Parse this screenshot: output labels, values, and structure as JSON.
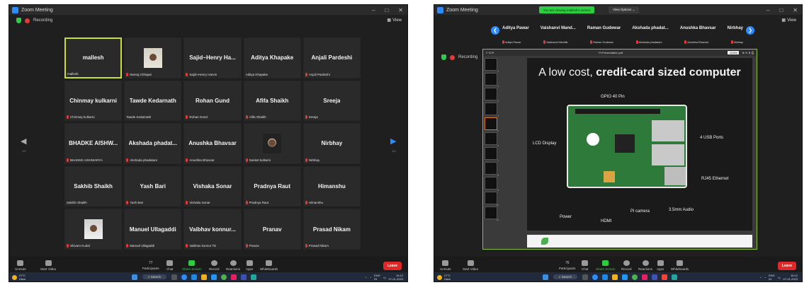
{
  "left": {
    "window_title": "Zoom Meeting",
    "recording": "Recording",
    "view": "View",
    "tiles": [
      {
        "name": "mallesh",
        "label": "mallesh",
        "active": true,
        "photo": "",
        "muted": false
      },
      {
        "name": "",
        "label": "Neeraj Chhajed",
        "active": false,
        "photo": "p1",
        "muted": true
      },
      {
        "name": "Sajid~Henry Ha...",
        "label": "Sajid~Henry Harvin",
        "active": false,
        "photo": "",
        "muted": true
      },
      {
        "name": "Aditya Khapake",
        "label": "Aditya Khapake",
        "active": false,
        "photo": "",
        "muted": false
      },
      {
        "name": "Anjali Pardeshi",
        "label": "Anjali Pardeshi",
        "active": false,
        "photo": "",
        "muted": true
      },
      {
        "name": "Chinmay kulkarni",
        "label": "Chinmay kulkarni",
        "active": false,
        "photo": "",
        "muted": true
      },
      {
        "name": "Tawde Kedarnath",
        "label": "Tawde Kedarnath",
        "active": false,
        "photo": "",
        "muted": false
      },
      {
        "name": "Rohan Gund",
        "label": "Rohan Gund",
        "active": false,
        "photo": "",
        "muted": true
      },
      {
        "name": "Afifa Shaikh",
        "label": "Afifa Shaikh",
        "active": false,
        "photo": "",
        "muted": true
      },
      {
        "name": "Sreeja",
        "label": "Sreeja",
        "active": false,
        "photo": "",
        "muted": true
      },
      {
        "name": "BHADKE AISHW...",
        "label": "BHADKE AISHWARYA",
        "active": false,
        "photo": "",
        "muted": true
      },
      {
        "name": "Akshada phadat...",
        "label": "Akshada phadatare",
        "active": false,
        "photo": "",
        "muted": true
      },
      {
        "name": "Anushka Bhavsar",
        "label": "Anushka Bhavsar",
        "active": false,
        "photo": "",
        "muted": true
      },
      {
        "name": "",
        "label": "Sanket kulkarni",
        "active": false,
        "photo": "p2",
        "muted": true
      },
      {
        "name": "Nirbhay",
        "label": "Nirbhay",
        "active": false,
        "photo": "",
        "muted": true
      },
      {
        "name": "Sakhib Shaikh",
        "label": "Sakhib Shaikh",
        "active": false,
        "photo": "",
        "muted": false
      },
      {
        "name": "Yash Bari",
        "label": "Yash Bari",
        "active": false,
        "photo": "",
        "muted": true
      },
      {
        "name": "Vishaka Sonar",
        "label": "Vishaka Sonar",
        "active": false,
        "photo": "",
        "muted": true
      },
      {
        "name": "Pradnya Raut",
        "label": "Pradnya Raut",
        "active": false,
        "photo": "",
        "muted": true
      },
      {
        "name": "Himanshu",
        "label": "Himanshu",
        "active": false,
        "photo": "",
        "muted": true
      },
      {
        "name": "",
        "label": "Shivam Kudal",
        "active": false,
        "photo": "p3",
        "muted": true
      },
      {
        "name": "Manuel Ullagaddi",
        "label": "Manuel Ullagaddi",
        "active": false,
        "photo": "",
        "muted": true
      },
      {
        "name": "Vaibhav konnur...",
        "label": "Vaibhav konnur TE",
        "active": false,
        "photo": "",
        "muted": true
      },
      {
        "name": "Pranav",
        "label": "Pranav",
        "active": false,
        "photo": "",
        "muted": true
      },
      {
        "name": "Prasad Nikam",
        "label": "Prasad Nikam",
        "active": false,
        "photo": "",
        "muted": true
      }
    ],
    "page_left": "1/2",
    "page_right": "1/2"
  },
  "toolbar": {
    "unmute": "Unmute",
    "start_video": "Start Video",
    "participants": "Participants",
    "participants_count": "77",
    "chat": "Chat",
    "share_screen": "Share Screen",
    "record": "Record",
    "reactions": "Reactions",
    "apps": "Apps",
    "whiteboards": "Whiteboards",
    "leave": "Leave"
  },
  "taskbar": {
    "temp": "27°C",
    "weather": "Haze",
    "search": "Search",
    "lang": "ENG",
    "region": "IN",
    "time": "16:12",
    "date": "07-01-2023"
  },
  "right": {
    "window_title": "Zoom Meeting",
    "share_banner": "You are viewing mallesh's screen",
    "view_options": "View Options ⌄",
    "recording": "Recording",
    "strip": [
      "Aditya Pawar",
      "Vaishanvi Mand...",
      "Raman Gudewar",
      "Akshada phadat...",
      "Anushka Bhavsar",
      "Nirbhay"
    ],
    "strip_labels": [
      "Aditya Pawar",
      "Vaishanvi Mandlik",
      "Raman Gudewar",
      "Akshada phadatare",
      "Anushka Bhavsar",
      "Nirbhay"
    ],
    "pdf_name": "Pi-Presentation.pdf",
    "zoom_level": "104%",
    "thumb_numbers": [
      "1",
      "2",
      "3",
      "4",
      "5",
      "6",
      "7",
      "8",
      "9",
      "10",
      "11"
    ],
    "slide_title_plain": "A low cost, ",
    "slide_title_bold": "credit-card sized computer",
    "labels": {
      "gpio": "GPIO 40 Pin",
      "usb": "4 USB Ports",
      "lcd": "LCD Display",
      "ethernet": "RJ45 Ethernet",
      "audio": "3.5mm Audio",
      "power": "Power",
      "hdmi": "HDMI",
      "camera": "Pi camera"
    },
    "toolbar": {
      "participants_count": "76"
    }
  }
}
